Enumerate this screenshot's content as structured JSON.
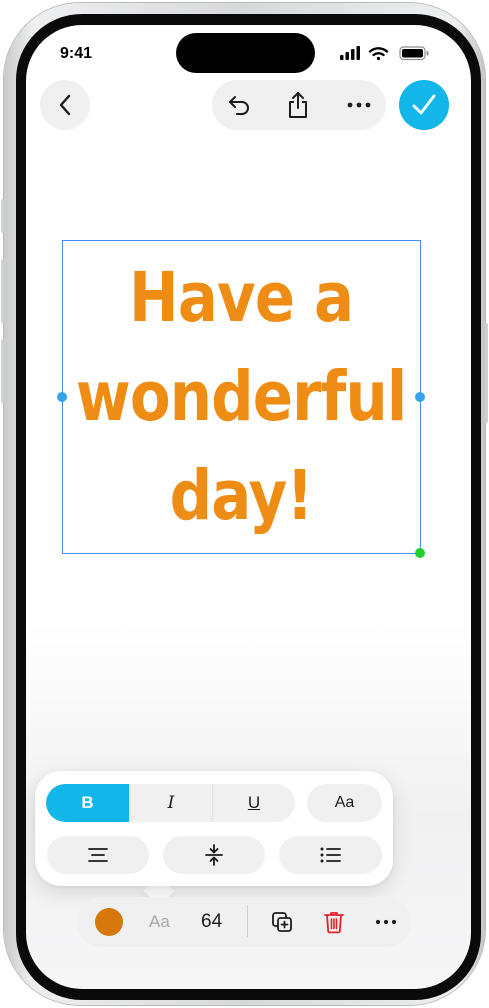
{
  "status_bar": {
    "time": "9:41"
  },
  "icons": {
    "back": "chevron-left-icon",
    "undo": "undo-icon",
    "share": "share-icon",
    "more": "ellipsis-icon",
    "done": "checkmark-icon",
    "align": "align-center-icon",
    "vertical_align": "vertical-center-icon",
    "list": "bullet-list-icon",
    "duplicate": "duplicate-icon",
    "delete": "trash-icon"
  },
  "canvas": {
    "text_lines": [
      "Have a",
      "wonderful",
      "day!"
    ],
    "text_color": "#ef8c13"
  },
  "format_popover": {
    "bold_label": "B",
    "italic_label": "I",
    "underline_label": "U",
    "font_button_label": "Aa"
  },
  "bottom_toolbar": {
    "color_swatch": "#d5770a",
    "font_label": "Aa",
    "font_size": "64"
  },
  "colors": {
    "accent": "#13b6e8",
    "delete": "#e0242b",
    "selection": "#4a8bef"
  }
}
